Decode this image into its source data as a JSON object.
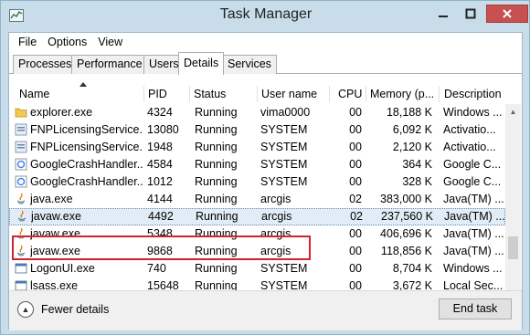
{
  "window": {
    "title": "Task Manager",
    "icons": {
      "app": "task-manager-icon",
      "minimize": "minimize-icon",
      "maximize": "maximize-icon",
      "close": "close-icon"
    },
    "close_color": "#c75050"
  },
  "menu": [
    "File",
    "Options",
    "View"
  ],
  "tabs": [
    {
      "label": "Processes",
      "active": false
    },
    {
      "label": "Performance",
      "active": false
    },
    {
      "label": "Users",
      "active": false
    },
    {
      "label": "Details",
      "active": true
    },
    {
      "label": "Services",
      "active": false
    }
  ],
  "table": {
    "sort_column": "Name",
    "sort_direction": "ascending",
    "columns": [
      "Name",
      "PID",
      "Status",
      "User name",
      "CPU",
      "Memory (p...",
      "Description"
    ],
    "rows": [
      {
        "icon": "folder-icon",
        "name": "explorer.exe",
        "pid": "4324",
        "status": "Running",
        "user": "vima0000",
        "cpu": "00",
        "mem": "18,188 K",
        "desc": "Windows ..."
      },
      {
        "icon": "service-icon",
        "name": "FNPLicensingService...",
        "pid": "13080",
        "status": "Running",
        "user": "SYSTEM",
        "cpu": "00",
        "mem": "6,092 K",
        "desc": "Activatio..."
      },
      {
        "icon": "service-icon",
        "name": "FNPLicensingService...",
        "pid": "1948",
        "status": "Running",
        "user": "SYSTEM",
        "cpu": "00",
        "mem": "2,120 K",
        "desc": "Activatio..."
      },
      {
        "icon": "google-icon",
        "name": "GoogleCrashHandler....",
        "pid": "4584",
        "status": "Running",
        "user": "SYSTEM",
        "cpu": "00",
        "mem": "364 K",
        "desc": "Google C..."
      },
      {
        "icon": "google-icon",
        "name": "GoogleCrashHandler....",
        "pid": "1012",
        "status": "Running",
        "user": "SYSTEM",
        "cpu": "00",
        "mem": "328 K",
        "desc": "Google C..."
      },
      {
        "icon": "java-icon",
        "name": "java.exe",
        "pid": "4144",
        "status": "Running",
        "user": "arcgis",
        "cpu": "02",
        "mem": "383,000 K",
        "desc": "Java(TM) ..."
      },
      {
        "icon": "java-icon",
        "name": "javaw.exe",
        "pid": "4492",
        "status": "Running",
        "user": "arcgis",
        "cpu": "02",
        "mem": "237,560 K",
        "desc": "Java(TM) ...",
        "selected": true
      },
      {
        "icon": "java-icon",
        "name": "javaw.exe",
        "pid": "5348",
        "status": "Running",
        "user": "arcgis",
        "cpu": "00",
        "mem": "406,696 K",
        "desc": "Java(TM) ..."
      },
      {
        "icon": "java-icon",
        "name": "javaw.exe",
        "pid": "9868",
        "status": "Running",
        "user": "arcgis",
        "cpu": "00",
        "mem": "118,856 K",
        "desc": "Java(TM) ..."
      },
      {
        "icon": "window-icon",
        "name": "LogonUI.exe",
        "pid": "740",
        "status": "Running",
        "user": "SYSTEM",
        "cpu": "00",
        "mem": "8,704 K",
        "desc": "Windows ..."
      },
      {
        "icon": "window-icon",
        "name": "lsass.exe",
        "pid": "15648",
        "status": "Running",
        "user": "SYSTEM",
        "cpu": "00",
        "mem": "3,672 K",
        "desc": "Local Sec..."
      }
    ]
  },
  "footer": {
    "fewer_details": "Fewer details",
    "fewer_icon": "chevron-up-icon",
    "end_task": "End task"
  },
  "annotation": {
    "color": "#d2232a"
  }
}
